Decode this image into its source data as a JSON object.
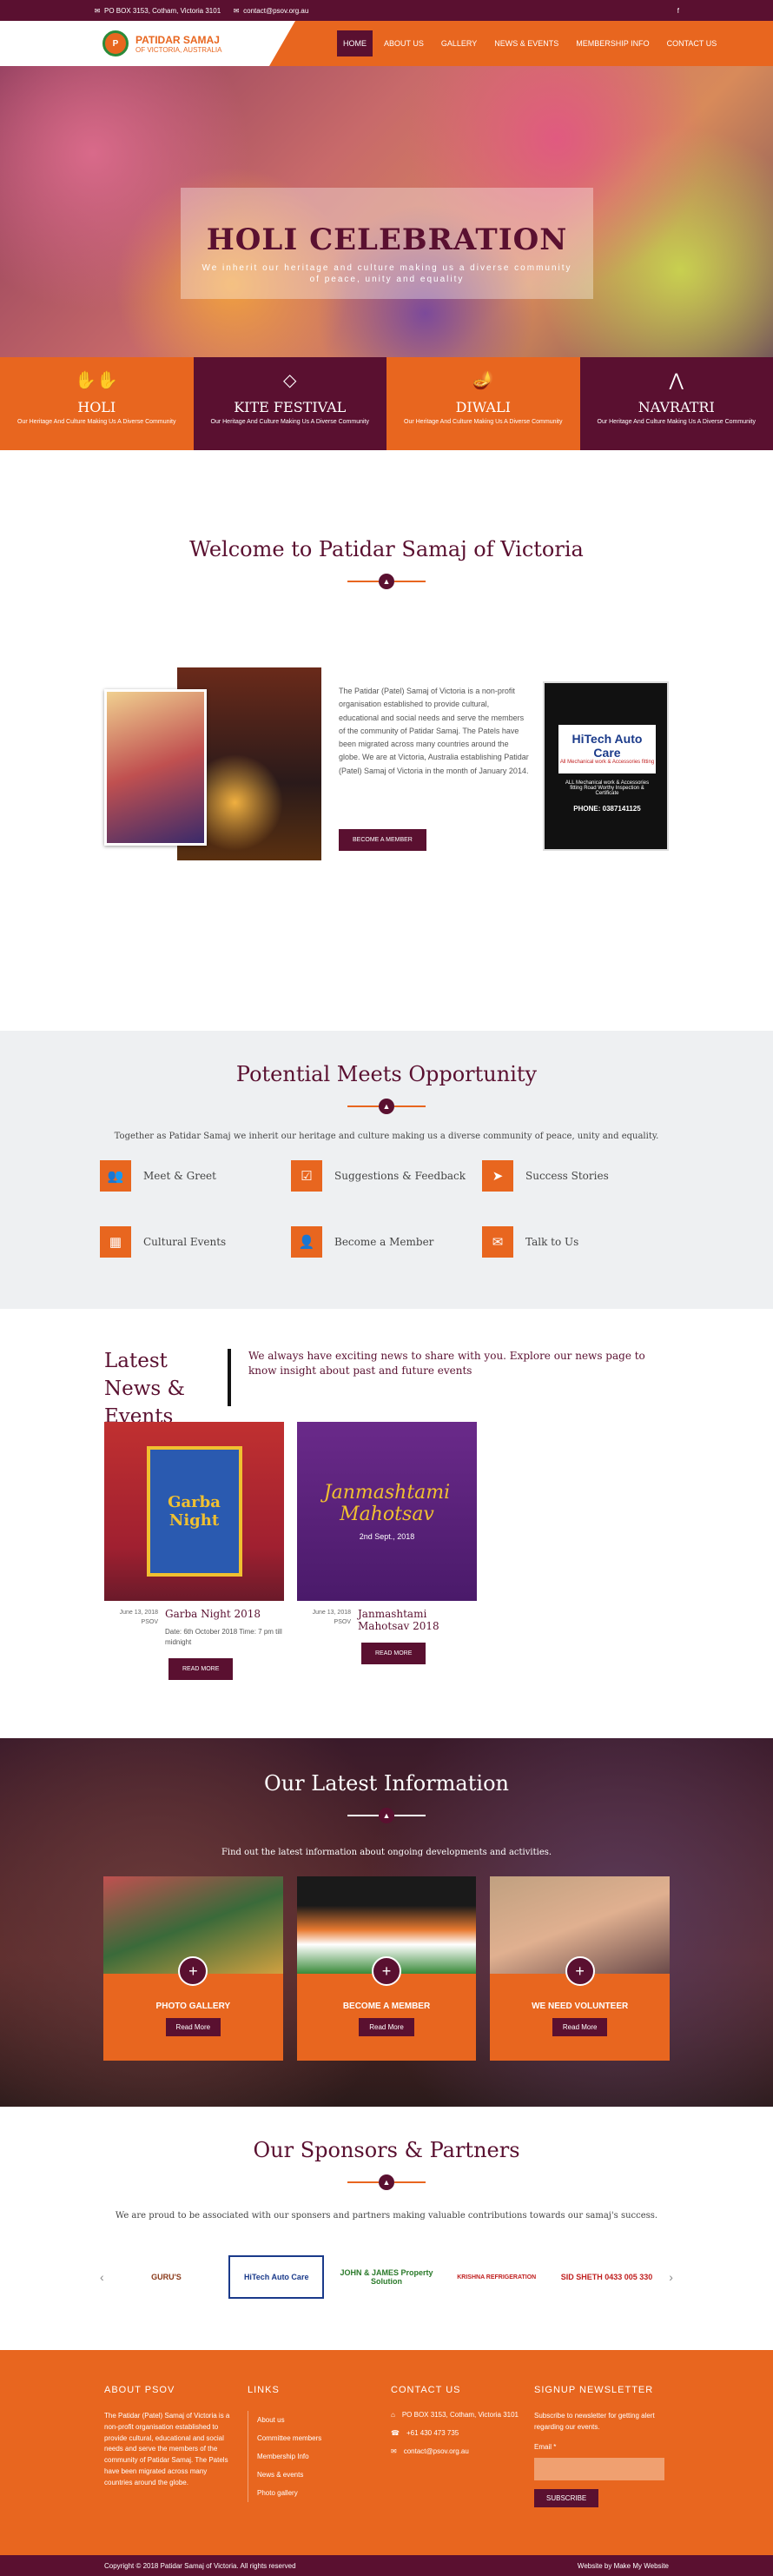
{
  "topbar": {
    "address": "PO BOX 3153, Cotham, Victoria 3101",
    "email": "contact@psov.org.au",
    "social": "f"
  },
  "logo": {
    "name": "PATIDAR SAMAJ",
    "subtitle": "OF VICTORIA, AUSTRALIA"
  },
  "nav": [
    "HOME",
    "ABOUT US",
    "GALLERY",
    "NEWS & EVENTS",
    "MEMBERSHIP INFO",
    "CONTACT US"
  ],
  "hero": {
    "title": "HOLI CELEBRATION",
    "subtitle": "We inherit our heritage and culture making us a diverse community of peace, unity and equality"
  },
  "festivals": [
    {
      "name": "HOLI",
      "desc": "Our Heritage And Culture Making Us A Diverse Community",
      "icon": "hands-icon"
    },
    {
      "name": "KITE FESTIVAL",
      "desc": "Our Heritage And Culture Making Us A Diverse Community",
      "icon": "kite-icon"
    },
    {
      "name": "DIWALI",
      "desc": "Our Heritage And Culture Making Us A Diverse Community",
      "icon": "lamp-icon"
    },
    {
      "name": "NAVRATRI",
      "desc": "Our Heritage And Culture Making Us A Diverse Community",
      "icon": "dandiya-icon"
    }
  ],
  "welcome": {
    "title": "Welcome to Patidar Samaj of Victoria",
    "text": "The Patidar (Patel) Samaj of Victoria is a non-profit organisation established to provide cultural, educational and social needs and serve the members of the community of Patidar Samaj. The Patels have been migrated across many countries around the globe. We are at Victoria, Australia establishing Patidar (Patel) Samaj of Victoria in the month of January 2014.",
    "button": "BECOME A MEMBER",
    "ad": {
      "brand": "HiTech Auto Care",
      "tag": "All Mechanical work & Accessories fitting",
      "text": "ALL Mechanical work & Accessories fitting Road Worthy Inspection & Certificate",
      "phone": "PHONE: 0387141125"
    }
  },
  "opportunity": {
    "title": "Potential Meets Opportunity",
    "subtitle": "Together as Patidar Samaj we inherit our heritage and culture making us a diverse community of peace, unity and equality.",
    "items": [
      {
        "label": "Meet & Greet",
        "icon": "users-icon"
      },
      {
        "label": "Suggestions & Feedback",
        "icon": "checkbox-icon"
      },
      {
        "label": "Success Stories",
        "icon": "paper-plane-icon"
      },
      {
        "label": "Cultural Events",
        "icon": "calendar-icon"
      },
      {
        "label": "Become a Member",
        "icon": "user-icon"
      },
      {
        "label": "Talk to Us",
        "icon": "envelope-icon"
      }
    ]
  },
  "news": {
    "title": "Latest News & Events",
    "intro": "We always have exciting news to share with you. Explore our news page to know insight about past and future events",
    "items": [
      {
        "date": "June 13, 2018",
        "author": "PSOV",
        "title": "Garba Night 2018",
        "desc": "Date: 6th October 2018 Time: 7 pm till midnight",
        "button": "READ MORE",
        "poster": "Garba Night"
      },
      {
        "date": "June 13, 2018",
        "author": "PSOV",
        "title": "Janmashtami Mahotsav 2018",
        "desc": "",
        "button": "READ MORE",
        "poster": "Janmashtami Mahotsav",
        "poster_date": "2nd Sept., 2018"
      }
    ]
  },
  "info": {
    "title": "Our Latest Information",
    "subtitle": "Find out the latest information about ongoing developments and activities.",
    "items": [
      {
        "label": "PHOTO GALLERY",
        "button": "Read More"
      },
      {
        "label": "BECOME A MEMBER",
        "button": "Read More"
      },
      {
        "label": "WE NEED VOLUNTEER",
        "button": "Read More"
      }
    ]
  },
  "sponsors": {
    "title": "Our Sponsors & Partners",
    "subtitle": "We are proud to be associated with our sponsers and partners making valuable contributions towards our samaj's success.",
    "items": [
      "GURU'S",
      "HiTech Auto Care",
      "JOHN & JAMES Property Solution",
      "KRISHNA REFRIGERATION",
      "SID SHETH 0433 005 330"
    ]
  },
  "footer": {
    "about_title": "ABOUT PSOV",
    "about_text": "The Patidar (Patel) Samaj of Victoria is a non-profit organisation established to provide cultural, educational and social needs and serve the members of the community of Patidar Samaj. The Patels have been migrated across many countries around the globe.",
    "links_title": "LINKS",
    "links": [
      "About us",
      "Committee members",
      "Membership Info",
      "News & events",
      "Photo gallery"
    ],
    "contact_title": "CONTACT US",
    "contact": [
      "PO BOX 3153, Cotham, Victoria 3101",
      "+61 430 473 735",
      "contact@psov.org.au"
    ],
    "newsletter_title": "SIGNUP NEWSLETTER",
    "newsletter_text": "Subscribe to newsletter for getting alert regarding our events.",
    "email_label": "Email *",
    "subscribe": "SUBSCRIBE",
    "copyright": "Copyright © 2018 Patidar Samaj of Victoria. All rights reserved",
    "credit": "Website by  Make My Website"
  },
  "colors": {
    "maroon": "#5a1030",
    "orange": "#e8661f"
  }
}
